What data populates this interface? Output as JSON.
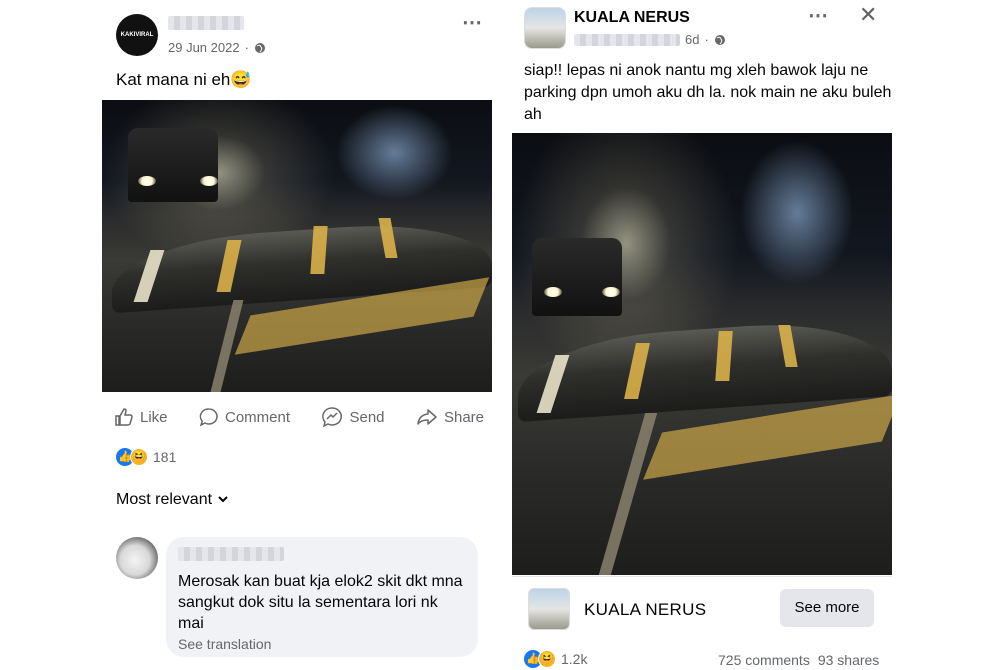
{
  "left_post": {
    "avatar_text": "KAKIVIRAL",
    "date": "29 Jun 2022",
    "caption": "Kat mana ni eh😅",
    "actions": {
      "like": "Like",
      "comment": "Comment",
      "send": "Send",
      "share": "Share"
    },
    "reaction_count": "181",
    "sort_label": "Most relevant",
    "comment": {
      "text": "Merosak kan buat kja elok2 skit dkt mna sangkut dok situ la sementara lori nk mai",
      "see_translation": "See translation"
    }
  },
  "right_post": {
    "page_name": "KUALA NERUS",
    "time": "6d",
    "caption": "siap!! lepas ni anok nantu mg xleh bawok laju ne parking dpn umoh aku dh la. nok main ne aku buleh ah",
    "footer_page_name": "KUALA NERUS",
    "see_more": "See more",
    "reaction_count": "1.2k",
    "comments": "725 comments",
    "shares": "93 shares"
  },
  "icons": {
    "more": "⋯",
    "close": "✕",
    "globe": "globe-icon",
    "like": "thumbs-up-icon",
    "comment": "comment-bubble-icon",
    "send": "messenger-icon",
    "share": "share-arrow-icon"
  }
}
